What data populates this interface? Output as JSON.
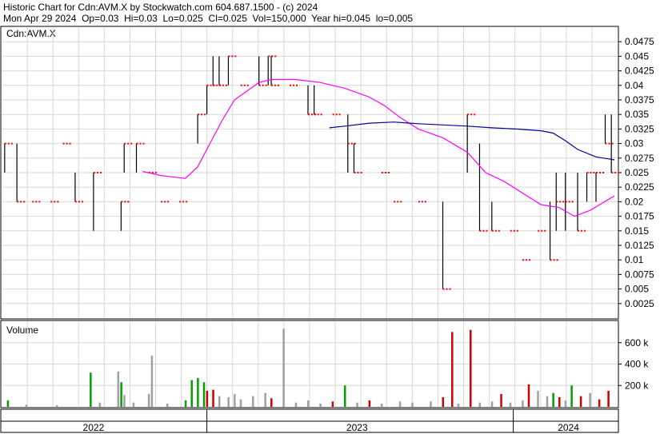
{
  "header": {
    "line1": "Historic Chart for Cdn:AVM.X by Stockwatch.com 604.687.1500 - (c) 2024",
    "line2": "Mon Apr 29 2024  Op=0.03  Hi=0.03  Lo=0.025  Cl=0.025  Vol=150,000  Year hi=0.045  lo=0.005"
  },
  "colors": {
    "price_tick": "#ff0000",
    "price_bar": "#000000",
    "ma_short": "#ff00ff",
    "ma_long": "#0000a0",
    "vol_up": "#00a000",
    "vol_down": "#d00000",
    "vol_flat": "#a0a0a0",
    "grid": "#d8d8d8"
  },
  "chart_data": [
    {
      "type": "ohlc",
      "title": "Cdn:AVM.X",
      "ylim": [
        0,
        0.05
      ],
      "y_ticks": [
        "0.0475",
        "0.045",
        "0.0425",
        "0.04",
        "0.0375",
        "0.035",
        "0.0325",
        "0.03",
        "0.0275",
        "0.025",
        "0.0225",
        "0.02",
        "0.0175",
        "0.015",
        "0.0125",
        "0.01",
        "0.0075",
        "0.005",
        "0.0025"
      ],
      "grid": true,
      "x_labels": [
        {
          "label": "2022",
          "at": 0.15
        },
        {
          "label": "2023",
          "at": 0.58
        },
        {
          "label": "2024",
          "at": 0.925
        }
      ],
      "x_range": [
        0,
        1
      ],
      "bars": [
        {
          "x": 0.005,
          "lo": 0.025,
          "hi": 0.03,
          "cl": 0.03
        },
        {
          "x": 0.025,
          "lo": 0.02,
          "hi": 0.03,
          "cl": 0.02
        },
        {
          "x": 0.05,
          "lo": 0.02,
          "hi": 0.02,
          "cl": 0.02
        },
        {
          "x": 0.08,
          "lo": 0.02,
          "hi": 0.02,
          "cl": 0.02
        },
        {
          "x": 0.1,
          "lo": 0.03,
          "hi": 0.03,
          "cl": 0.03
        },
        {
          "x": 0.12,
          "lo": 0.02,
          "hi": 0.025,
          "cl": 0.02
        },
        {
          "x": 0.15,
          "lo": 0.015,
          "hi": 0.025,
          "cl": 0.025
        },
        {
          "x": 0.195,
          "lo": 0.015,
          "hi": 0.02,
          "cl": 0.02
        },
        {
          "x": 0.2,
          "lo": 0.025,
          "hi": 0.03,
          "cl": 0.03
        },
        {
          "x": 0.22,
          "lo": 0.025,
          "hi": 0.03,
          "cl": 0.03
        },
        {
          "x": 0.24,
          "lo": 0.025,
          "hi": 0.025,
          "cl": 0.025
        },
        {
          "x": 0.26,
          "lo": 0.02,
          "hi": 0.02,
          "cl": 0.02
        },
        {
          "x": 0.29,
          "lo": 0.02,
          "hi": 0.02,
          "cl": 0.02
        },
        {
          "x": 0.32,
          "lo": 0.03,
          "hi": 0.035,
          "cl": 0.035
        },
        {
          "x": 0.335,
          "lo": 0.035,
          "hi": 0.04,
          "cl": 0.04
        },
        {
          "x": 0.345,
          "lo": 0.04,
          "hi": 0.045,
          "cl": 0.04
        },
        {
          "x": 0.355,
          "lo": 0.04,
          "hi": 0.045,
          "cl": 0.04
        },
        {
          "x": 0.37,
          "lo": 0.04,
          "hi": 0.045,
          "cl": 0.045
        },
        {
          "x": 0.39,
          "lo": 0.04,
          "hi": 0.04,
          "cl": 0.04
        },
        {
          "x": 0.42,
          "lo": 0.04,
          "hi": 0.045,
          "cl": 0.04
        },
        {
          "x": 0.435,
          "lo": 0.04,
          "hi": 0.045,
          "cl": 0.045
        },
        {
          "x": 0.44,
          "lo": 0.04,
          "hi": 0.045,
          "cl": 0.04
        },
        {
          "x": 0.47,
          "lo": 0.04,
          "hi": 0.04,
          "cl": 0.04
        },
        {
          "x": 0.5,
          "lo": 0.035,
          "hi": 0.04,
          "cl": 0.035
        },
        {
          "x": 0.51,
          "lo": 0.035,
          "hi": 0.04,
          "cl": 0.035
        },
        {
          "x": 0.54,
          "lo": 0.035,
          "hi": 0.035,
          "cl": 0.035
        },
        {
          "x": 0.565,
          "lo": 0.025,
          "hi": 0.035,
          "cl": 0.03
        },
        {
          "x": 0.575,
          "lo": 0.025,
          "hi": 0.03,
          "cl": 0.025
        },
        {
          "x": 0.62,
          "lo": 0.025,
          "hi": 0.025,
          "cl": 0.025
        },
        {
          "x": 0.64,
          "lo": 0.02,
          "hi": 0.02,
          "cl": 0.02
        },
        {
          "x": 0.68,
          "lo": 0.02,
          "hi": 0.02,
          "cl": 0.02
        },
        {
          "x": 0.72,
          "lo": 0.005,
          "hi": 0.02,
          "cl": 0.005
        },
        {
          "x": 0.76,
          "lo": 0.025,
          "hi": 0.035,
          "cl": 0.035
        },
        {
          "x": 0.78,
          "lo": 0.015,
          "hi": 0.03,
          "cl": 0.015
        },
        {
          "x": 0.8,
          "lo": 0.015,
          "hi": 0.02,
          "cl": 0.015
        },
        {
          "x": 0.83,
          "lo": 0.015,
          "hi": 0.015,
          "cl": 0.015
        },
        {
          "x": 0.85,
          "lo": 0.01,
          "hi": 0.01,
          "cl": 0.01
        },
        {
          "x": 0.875,
          "lo": 0.015,
          "hi": 0.015,
          "cl": 0.015
        },
        {
          "x": 0.895,
          "lo": 0.01,
          "hi": 0.02,
          "cl": 0.01
        },
        {
          "x": 0.905,
          "lo": 0.015,
          "hi": 0.025,
          "cl": 0.02
        },
        {
          "x": 0.92,
          "lo": 0.015,
          "hi": 0.025,
          "cl": 0.02
        },
        {
          "x": 0.94,
          "lo": 0.015,
          "hi": 0.025,
          "cl": 0.015
        },
        {
          "x": 0.955,
          "lo": 0.02,
          "hi": 0.025,
          "cl": 0.025
        },
        {
          "x": 0.97,
          "lo": 0.02,
          "hi": 0.025,
          "cl": 0.025
        },
        {
          "x": 0.985,
          "lo": 0.03,
          "hi": 0.035,
          "cl": 0.03
        },
        {
          "x": 0.995,
          "lo": 0.025,
          "hi": 0.035,
          "cl": 0.025
        }
      ],
      "series": [
        {
          "values": [
            [
              0.23,
              0.0252
            ],
            [
              0.26,
              0.0245
            ],
            [
              0.3,
              0.024
            ],
            [
              0.32,
              0.026
            ],
            [
              0.34,
              0.03
            ],
            [
              0.36,
              0.034
            ],
            [
              0.38,
              0.0375
            ],
            [
              0.4,
              0.039
            ],
            [
              0.42,
              0.0405
            ],
            [
              0.44,
              0.041
            ],
            [
              0.48,
              0.041
            ],
            [
              0.52,
              0.0405
            ],
            [
              0.56,
              0.0395
            ],
            [
              0.6,
              0.038
            ],
            [
              0.625,
              0.0365
            ],
            [
              0.65,
              0.0345
            ],
            [
              0.68,
              0.0325
            ],
            [
              0.72,
              0.031
            ],
            [
              0.76,
              0.0285
            ],
            [
              0.79,
              0.025
            ],
            [
              0.82,
              0.0235
            ],
            [
              0.85,
              0.0215
            ],
            [
              0.88,
              0.0195
            ],
            [
              0.91,
              0.019
            ],
            [
              0.935,
              0.0175
            ],
            [
              0.96,
              0.0185
            ],
            [
              1.0,
              0.021
            ]
          ]
        },
        {
          "values": [
            [
              0.535,
              0.0327
            ],
            [
              0.56,
              0.033
            ],
            [
              0.6,
              0.0335
            ],
            [
              0.64,
              0.0337
            ],
            [
              0.68,
              0.0334
            ],
            [
              0.72,
              0.0332
            ],
            [
              0.76,
              0.033
            ],
            [
              0.8,
              0.0327
            ],
            [
              0.84,
              0.0325
            ],
            [
              0.88,
              0.0322
            ],
            [
              0.9,
              0.0318
            ],
            [
              0.92,
              0.0305
            ],
            [
              0.94,
              0.029
            ],
            [
              0.97,
              0.0277
            ],
            [
              1.0,
              0.0272
            ]
          ]
        }
      ]
    },
    {
      "type": "bar",
      "title": "Volume",
      "ylim": [
        0,
        800000
      ],
      "y_ticks": [
        {
          "v": 600000,
          "label": "600 k"
        },
        {
          "v": 400000,
          "label": "400 k"
        },
        {
          "v": 200000,
          "label": "200 k"
        }
      ],
      "volumes": [
        {
          "x": 0.01,
          "v": 60000,
          "c": "up"
        },
        {
          "x": 0.04,
          "v": 20000,
          "c": "flat"
        },
        {
          "x": 0.09,
          "v": 15000,
          "c": "flat"
        },
        {
          "x": 0.145,
          "v": 320000,
          "c": "up"
        },
        {
          "x": 0.16,
          "v": 40000,
          "c": "flat"
        },
        {
          "x": 0.19,
          "v": 330000,
          "c": "flat"
        },
        {
          "x": 0.195,
          "v": 230000,
          "c": "up"
        },
        {
          "x": 0.2,
          "v": 110000,
          "c": "flat"
        },
        {
          "x": 0.215,
          "v": 40000,
          "c": "flat"
        },
        {
          "x": 0.24,
          "v": 120000,
          "c": "flat"
        },
        {
          "x": 0.245,
          "v": 480000,
          "c": "flat"
        },
        {
          "x": 0.27,
          "v": 30000,
          "c": "flat"
        },
        {
          "x": 0.3,
          "v": 60000,
          "c": "up"
        },
        {
          "x": 0.31,
          "v": 250000,
          "c": "up"
        },
        {
          "x": 0.32,
          "v": 270000,
          "c": "up"
        },
        {
          "x": 0.33,
          "v": 230000,
          "c": "up"
        },
        {
          "x": 0.335,
          "v": 150000,
          "c": "down"
        },
        {
          "x": 0.345,
          "v": 160000,
          "c": "down"
        },
        {
          "x": 0.355,
          "v": 100000,
          "c": "flat"
        },
        {
          "x": 0.37,
          "v": 90000,
          "c": "flat"
        },
        {
          "x": 0.38,
          "v": 120000,
          "c": "flat"
        },
        {
          "x": 0.39,
          "v": 70000,
          "c": "flat"
        },
        {
          "x": 0.41,
          "v": 100000,
          "c": "flat"
        },
        {
          "x": 0.43,
          "v": 130000,
          "c": "flat"
        },
        {
          "x": 0.44,
          "v": 80000,
          "c": "down"
        },
        {
          "x": 0.46,
          "v": 730000,
          "c": "flat"
        },
        {
          "x": 0.48,
          "v": 40000,
          "c": "flat"
        },
        {
          "x": 0.5,
          "v": 60000,
          "c": "flat"
        },
        {
          "x": 0.52,
          "v": 30000,
          "c": "flat"
        },
        {
          "x": 0.54,
          "v": 50000,
          "c": "down"
        },
        {
          "x": 0.56,
          "v": 200000,
          "c": "up"
        },
        {
          "x": 0.58,
          "v": 40000,
          "c": "flat"
        },
        {
          "x": 0.6,
          "v": 60000,
          "c": "down"
        },
        {
          "x": 0.62,
          "v": 30000,
          "c": "flat"
        },
        {
          "x": 0.65,
          "v": 50000,
          "c": "flat"
        },
        {
          "x": 0.67,
          "v": 40000,
          "c": "flat"
        },
        {
          "x": 0.7,
          "v": 50000,
          "c": "flat"
        },
        {
          "x": 0.72,
          "v": 90000,
          "c": "down"
        },
        {
          "x": 0.735,
          "v": 700000,
          "c": "down"
        },
        {
          "x": 0.745,
          "v": 30000,
          "c": "flat"
        },
        {
          "x": 0.765,
          "v": 720000,
          "c": "down"
        },
        {
          "x": 0.78,
          "v": 40000,
          "c": "flat"
        },
        {
          "x": 0.8,
          "v": 50000,
          "c": "flat"
        },
        {
          "x": 0.815,
          "v": 120000,
          "c": "down"
        },
        {
          "x": 0.83,
          "v": 40000,
          "c": "flat"
        },
        {
          "x": 0.85,
          "v": 60000,
          "c": "flat"
        },
        {
          "x": 0.86,
          "v": 210000,
          "c": "down"
        },
        {
          "x": 0.875,
          "v": 150000,
          "c": "flat"
        },
        {
          "x": 0.89,
          "v": 100000,
          "c": "flat"
        },
        {
          "x": 0.9,
          "v": 130000,
          "c": "up"
        },
        {
          "x": 0.91,
          "v": 90000,
          "c": "down"
        },
        {
          "x": 0.92,
          "v": 60000,
          "c": "flat"
        },
        {
          "x": 0.93,
          "v": 200000,
          "c": "up"
        },
        {
          "x": 0.945,
          "v": 100000,
          "c": "down"
        },
        {
          "x": 0.96,
          "v": 130000,
          "c": "flat"
        },
        {
          "x": 0.975,
          "v": 70000,
          "c": "down"
        },
        {
          "x": 0.99,
          "v": 150000,
          "c": "down"
        }
      ]
    }
  ]
}
